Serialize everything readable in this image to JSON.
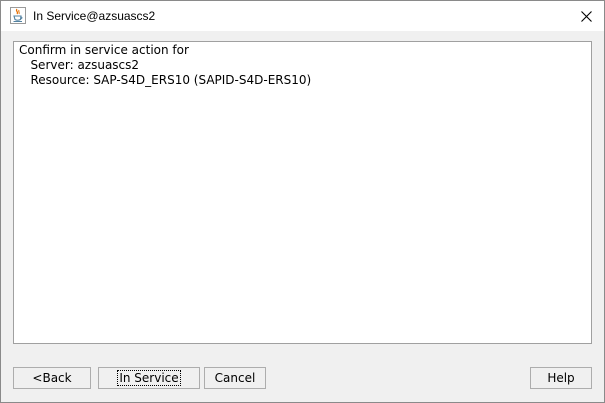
{
  "window": {
    "title": "In Service@azsuascs2",
    "app_icon": "java-cup-icon",
    "close_icon": "close-icon"
  },
  "message": {
    "line1": "Confirm in service action for",
    "line2": "   Server: azsuascs2",
    "line3": "   Resource: SAP-S4D_ERS10 (SAPID-S4D-ERS10)"
  },
  "buttons": {
    "back": "<Back",
    "in_service": "In Service",
    "cancel": "Cancel",
    "help": "Help"
  }
}
